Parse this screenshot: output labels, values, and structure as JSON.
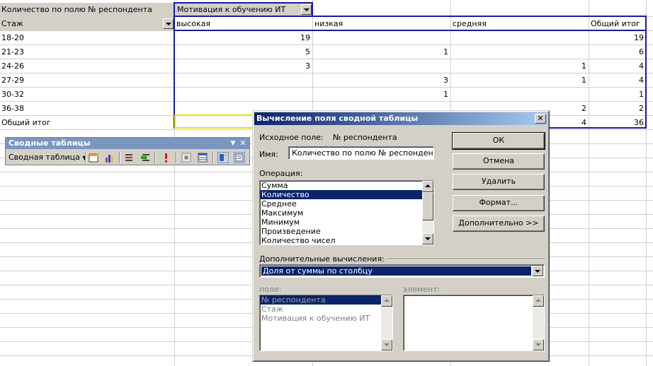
{
  "pivot": {
    "data_field_label": "Количество по полю № респондента",
    "column_field_label": "Мотивация к обучению ИТ",
    "row_field_label": "Стаж",
    "column_headers": [
      "высокая",
      "низкая",
      "средняя",
      "Общий итог"
    ],
    "rows": [
      {
        "label": "18-20",
        "values": [
          "19",
          "",
          "",
          "19"
        ]
      },
      {
        "label": "21-23",
        "values": [
          "5",
          "1",
          "",
          "6"
        ]
      },
      {
        "label": "24-26",
        "values": [
          "3",
          "",
          "1",
          "4"
        ]
      },
      {
        "label": "27-29",
        "values": [
          "",
          "3",
          "1",
          "4"
        ]
      },
      {
        "label": "30-32",
        "values": [
          "",
          "1",
          "",
          "1"
        ]
      },
      {
        "label": "36-38",
        "values": [
          "",
          "",
          "2",
          "2"
        ]
      }
    ],
    "grand_total": {
      "label": "Общий итог",
      "values": [
        "",
        "",
        "4",
        "36"
      ]
    }
  },
  "toolbar": {
    "title": "Сводные таблицы",
    "menu_label": "Сводная таблица",
    "icons": [
      "format-report-icon",
      "chart-wizard-icon",
      "hide-detail-icon",
      "show-detail-icon",
      "refresh-icon",
      "field-settings-icon",
      "table-options-icon",
      "field-list-icon",
      "pivot-layout-icon"
    ]
  },
  "dialog": {
    "title": "Вычисление поля сводной таблицы",
    "source_field_label": "Исходное поле:",
    "source_field_value": "№ респондента",
    "name_label": "Имя:",
    "name_value": "Количество по полю № респондента",
    "operation_label": "Операция:",
    "operations": [
      "Сумма",
      "Количество",
      "Среднее",
      "Максимум",
      "Минимум",
      "Произведение",
      "Количество чисел"
    ],
    "selected_operation": "Количество",
    "buttons": {
      "ok": "ОК",
      "cancel": "Отмена",
      "delete": "Удалить",
      "format": "Формат...",
      "more": "Дополнительно >>"
    },
    "additional_calc_label": "Дополнительные вычисления:",
    "additional_calc_value": "Доля от суммы по столбцу",
    "field_label": "поле:",
    "fields": [
      "№ респондента",
      "Стаж",
      "Мотивация к обучению ИТ"
    ],
    "element_label": "элемент:",
    "elements": []
  }
}
